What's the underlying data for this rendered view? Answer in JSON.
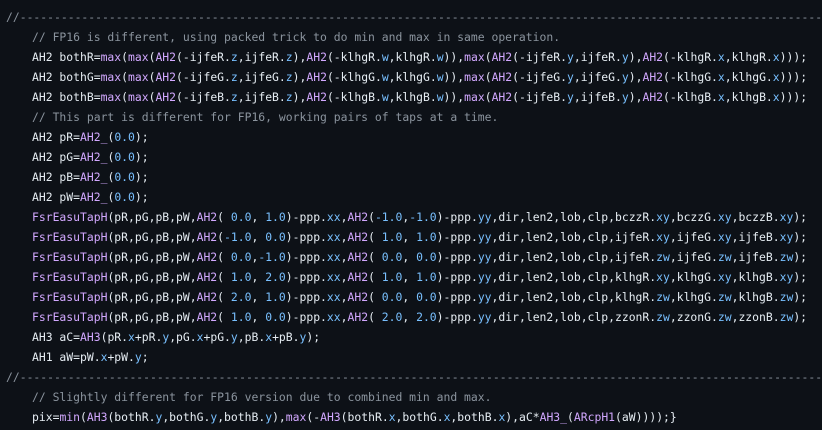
{
  "colors": {
    "background": "#0d1117",
    "plain": "#e6edf3",
    "keyword": "#d2a8ff",
    "number": "#79c0ff",
    "comment": "#8b949e"
  },
  "lines": [
    {
      "kind": "sep",
      "tokens": [
        [
          "c",
          "//---------------------------------------------------------------------------------------------------------------------"
        ]
      ]
    },
    {
      "kind": "c1",
      "tokens": [
        [
          "c",
          "// FP16 is different, using packed trick to do min and max in same operation."
        ]
      ]
    },
    {
      "kind": "c1",
      "tokens": [
        [
          "p",
          "AH2 bothR="
        ],
        [
          "k",
          "max"
        ],
        [
          "p",
          "("
        ],
        [
          "k",
          "max"
        ],
        [
          "p",
          "("
        ],
        [
          "k",
          "AH2"
        ],
        [
          "p",
          "(-ijfeR."
        ],
        [
          "n",
          "z"
        ],
        [
          "p",
          ",ijfeR."
        ],
        [
          "n",
          "z"
        ],
        [
          "p",
          "),"
        ],
        [
          "k",
          "AH2"
        ],
        [
          "p",
          "(-klhgR."
        ],
        [
          "n",
          "w"
        ],
        [
          "p",
          ",klhgR."
        ],
        [
          "n",
          "w"
        ],
        [
          "p",
          "))"
        ],
        [
          "p",
          ","
        ],
        [
          "k",
          "max"
        ],
        [
          "p",
          "("
        ],
        [
          "k",
          "AH2"
        ],
        [
          "p",
          "(-ijfeR."
        ],
        [
          "n",
          "y"
        ],
        [
          "p",
          ",ijfeR."
        ],
        [
          "n",
          "y"
        ],
        [
          "p",
          "),"
        ],
        [
          "k",
          "AH2"
        ],
        [
          "p",
          "(-klhgR."
        ],
        [
          "n",
          "x"
        ],
        [
          "p",
          ",klhgR."
        ],
        [
          "n",
          "x"
        ],
        [
          "p",
          ")));"
        ]
      ]
    },
    {
      "kind": "c1",
      "tokens": [
        [
          "p",
          "AH2 bothG="
        ],
        [
          "k",
          "max"
        ],
        [
          "p",
          "("
        ],
        [
          "k",
          "max"
        ],
        [
          "p",
          "("
        ],
        [
          "k",
          "AH2"
        ],
        [
          "p",
          "(-ijfeG."
        ],
        [
          "n",
          "z"
        ],
        [
          "p",
          ",ijfeG."
        ],
        [
          "n",
          "z"
        ],
        [
          "p",
          "),"
        ],
        [
          "k",
          "AH2"
        ],
        [
          "p",
          "(-klhgG."
        ],
        [
          "n",
          "w"
        ],
        [
          "p",
          ",klhgG."
        ],
        [
          "n",
          "w"
        ],
        [
          "p",
          "))"
        ],
        [
          "p",
          ","
        ],
        [
          "k",
          "max"
        ],
        [
          "p",
          "("
        ],
        [
          "k",
          "AH2"
        ],
        [
          "p",
          "(-ijfeG."
        ],
        [
          "n",
          "y"
        ],
        [
          "p",
          ",ijfeG."
        ],
        [
          "n",
          "y"
        ],
        [
          "p",
          "),"
        ],
        [
          "k",
          "AH2"
        ],
        [
          "p",
          "(-klhgG."
        ],
        [
          "n",
          "x"
        ],
        [
          "p",
          ",klhgG."
        ],
        [
          "n",
          "x"
        ],
        [
          "p",
          ")));"
        ]
      ]
    },
    {
      "kind": "c1",
      "tokens": [
        [
          "p",
          "AH2 bothB="
        ],
        [
          "k",
          "max"
        ],
        [
          "p",
          "("
        ],
        [
          "k",
          "max"
        ],
        [
          "p",
          "("
        ],
        [
          "k",
          "AH2"
        ],
        [
          "p",
          "(-ijfeB."
        ],
        [
          "n",
          "z"
        ],
        [
          "p",
          ",ijfeB."
        ],
        [
          "n",
          "z"
        ],
        [
          "p",
          "),"
        ],
        [
          "k",
          "AH2"
        ],
        [
          "p",
          "(-klhgB."
        ],
        [
          "n",
          "w"
        ],
        [
          "p",
          ",klhgB."
        ],
        [
          "n",
          "w"
        ],
        [
          "p",
          "))"
        ],
        [
          "p",
          ","
        ],
        [
          "k",
          "max"
        ],
        [
          "p",
          "("
        ],
        [
          "k",
          "AH2"
        ],
        [
          "p",
          "(-ijfeB."
        ],
        [
          "n",
          "y"
        ],
        [
          "p",
          ",ijfeB."
        ],
        [
          "n",
          "y"
        ],
        [
          "p",
          "),"
        ],
        [
          "k",
          "AH2"
        ],
        [
          "p",
          "(-klhgB."
        ],
        [
          "n",
          "x"
        ],
        [
          "p",
          ",klhgB."
        ],
        [
          "n",
          "x"
        ],
        [
          "p",
          ")));"
        ]
      ]
    },
    {
      "kind": "c1",
      "tokens": [
        [
          "c",
          "// This part is different for FP16, working pairs of taps at a time."
        ]
      ]
    },
    {
      "kind": "c1",
      "tokens": [
        [
          "p",
          "AH2 pR="
        ],
        [
          "k",
          "AH2_"
        ],
        [
          "p",
          "("
        ],
        [
          "n",
          "0.0"
        ],
        [
          "p",
          ");"
        ]
      ]
    },
    {
      "kind": "c1",
      "tokens": [
        [
          "p",
          "AH2 pG="
        ],
        [
          "k",
          "AH2_"
        ],
        [
          "p",
          "("
        ],
        [
          "n",
          "0.0"
        ],
        [
          "p",
          ");"
        ]
      ]
    },
    {
      "kind": "c1",
      "tokens": [
        [
          "p",
          "AH2 pB="
        ],
        [
          "k",
          "AH2_"
        ],
        [
          "p",
          "("
        ],
        [
          "n",
          "0.0"
        ],
        [
          "p",
          ");"
        ]
      ]
    },
    {
      "kind": "c1",
      "tokens": [
        [
          "p",
          "AH2 pW="
        ],
        [
          "k",
          "AH2_"
        ],
        [
          "p",
          "("
        ],
        [
          "n",
          "0.0"
        ],
        [
          "p",
          ");"
        ]
      ]
    },
    {
      "kind": "c1",
      "tokens": [
        [
          "k",
          "FsrEasuTapH"
        ],
        [
          "p",
          "(pR,pG,pB,pW,"
        ],
        [
          "k",
          "AH2"
        ],
        [
          "p",
          "( "
        ],
        [
          "n",
          "0.0"
        ],
        [
          "p",
          ", "
        ],
        [
          "n",
          "1.0"
        ],
        [
          "p",
          ")-ppp."
        ],
        [
          "n",
          "xx"
        ],
        [
          "p",
          ","
        ],
        [
          "k",
          "AH2"
        ],
        [
          "p",
          "("
        ],
        [
          "n",
          "-1.0"
        ],
        [
          "p",
          ","
        ],
        [
          "n",
          "-1.0"
        ],
        [
          "p",
          ")-ppp."
        ],
        [
          "n",
          "yy"
        ],
        [
          "p",
          ",dir,len2,lob,clp,bczzR."
        ],
        [
          "n",
          "xy"
        ],
        [
          "p",
          ",bczzG."
        ],
        [
          "n",
          "xy"
        ],
        [
          "p",
          ",bczzB."
        ],
        [
          "n",
          "xy"
        ],
        [
          "p",
          ");"
        ]
      ]
    },
    {
      "kind": "c1",
      "tokens": [
        [
          "k",
          "FsrEasuTapH"
        ],
        [
          "p",
          "(pR,pG,pB,pW,"
        ],
        [
          "k",
          "AH2"
        ],
        [
          "p",
          "("
        ],
        [
          "n",
          "-1.0"
        ],
        [
          "p",
          ", "
        ],
        [
          "n",
          "0.0"
        ],
        [
          "p",
          ")-ppp."
        ],
        [
          "n",
          "xx"
        ],
        [
          "p",
          ","
        ],
        [
          "k",
          "AH2"
        ],
        [
          "p",
          "( "
        ],
        [
          "n",
          "1.0"
        ],
        [
          "p",
          ", "
        ],
        [
          "n",
          "1.0"
        ],
        [
          "p",
          ")-ppp."
        ],
        [
          "n",
          "yy"
        ],
        [
          "p",
          ",dir,len2,lob,clp,ijfeR."
        ],
        [
          "n",
          "xy"
        ],
        [
          "p",
          ",ijfeG."
        ],
        [
          "n",
          "xy"
        ],
        [
          "p",
          ",ijfeB."
        ],
        [
          "n",
          "xy"
        ],
        [
          "p",
          ");"
        ]
      ]
    },
    {
      "kind": "c1",
      "tokens": [
        [
          "k",
          "FsrEasuTapH"
        ],
        [
          "p",
          "(pR,pG,pB,pW,"
        ],
        [
          "k",
          "AH2"
        ],
        [
          "p",
          "( "
        ],
        [
          "n",
          "0.0"
        ],
        [
          "p",
          ","
        ],
        [
          "n",
          "-1.0"
        ],
        [
          "p",
          ")-ppp."
        ],
        [
          "n",
          "xx"
        ],
        [
          "p",
          ","
        ],
        [
          "k",
          "AH2"
        ],
        [
          "p",
          "( "
        ],
        [
          "n",
          "0.0"
        ],
        [
          "p",
          ", "
        ],
        [
          "n",
          "0.0"
        ],
        [
          "p",
          ")-ppp."
        ],
        [
          "n",
          "yy"
        ],
        [
          "p",
          ",dir,len2,lob,clp,ijfeR."
        ],
        [
          "n",
          "zw"
        ],
        [
          "p",
          ",ijfeG."
        ],
        [
          "n",
          "zw"
        ],
        [
          "p",
          ",ijfeB."
        ],
        [
          "n",
          "zw"
        ],
        [
          "p",
          ");"
        ]
      ]
    },
    {
      "kind": "c1",
      "tokens": [
        [
          "k",
          "FsrEasuTapH"
        ],
        [
          "p",
          "(pR,pG,pB,pW,"
        ],
        [
          "k",
          "AH2"
        ],
        [
          "p",
          "( "
        ],
        [
          "n",
          "1.0"
        ],
        [
          "p",
          ", "
        ],
        [
          "n",
          "2.0"
        ],
        [
          "p",
          ")-ppp."
        ],
        [
          "n",
          "xx"
        ],
        [
          "p",
          ","
        ],
        [
          "k",
          "AH2"
        ],
        [
          "p",
          "( "
        ],
        [
          "n",
          "1.0"
        ],
        [
          "p",
          ", "
        ],
        [
          "n",
          "1.0"
        ],
        [
          "p",
          ")-ppp."
        ],
        [
          "n",
          "yy"
        ],
        [
          "p",
          ",dir,len2,lob,clp,klhgR."
        ],
        [
          "n",
          "xy"
        ],
        [
          "p",
          ",klhgG."
        ],
        [
          "n",
          "xy"
        ],
        [
          "p",
          ",klhgB."
        ],
        [
          "n",
          "xy"
        ],
        [
          "p",
          ");"
        ]
      ]
    },
    {
      "kind": "c1",
      "tokens": [
        [
          "k",
          "FsrEasuTapH"
        ],
        [
          "p",
          "(pR,pG,pB,pW,"
        ],
        [
          "k",
          "AH2"
        ],
        [
          "p",
          "( "
        ],
        [
          "n",
          "2.0"
        ],
        [
          "p",
          ", "
        ],
        [
          "n",
          "1.0"
        ],
        [
          "p",
          ")-ppp."
        ],
        [
          "n",
          "xx"
        ],
        [
          "p",
          ","
        ],
        [
          "k",
          "AH2"
        ],
        [
          "p",
          "( "
        ],
        [
          "n",
          "0.0"
        ],
        [
          "p",
          ", "
        ],
        [
          "n",
          "0.0"
        ],
        [
          "p",
          ")-ppp."
        ],
        [
          "n",
          "yy"
        ],
        [
          "p",
          ",dir,len2,lob,clp,klhgR."
        ],
        [
          "n",
          "zw"
        ],
        [
          "p",
          ",klhgG."
        ],
        [
          "n",
          "zw"
        ],
        [
          "p",
          ",klhgB."
        ],
        [
          "n",
          "zw"
        ],
        [
          "p",
          ");"
        ]
      ]
    },
    {
      "kind": "c1",
      "tokens": [
        [
          "k",
          "FsrEasuTapH"
        ],
        [
          "p",
          "(pR,pG,pB,pW,"
        ],
        [
          "k",
          "AH2"
        ],
        [
          "p",
          "( "
        ],
        [
          "n",
          "1.0"
        ],
        [
          "p",
          ", "
        ],
        [
          "n",
          "0.0"
        ],
        [
          "p",
          ")-ppp."
        ],
        [
          "n",
          "xx"
        ],
        [
          "p",
          ","
        ],
        [
          "k",
          "AH2"
        ],
        [
          "p",
          "( "
        ],
        [
          "n",
          "2.0"
        ],
        [
          "p",
          ", "
        ],
        [
          "n",
          "2.0"
        ],
        [
          "p",
          ")-ppp."
        ],
        [
          "n",
          "yy"
        ],
        [
          "p",
          ",dir,len2,lob,clp,zzonR."
        ],
        [
          "n",
          "zw"
        ],
        [
          "p",
          ",zzonG."
        ],
        [
          "n",
          "zw"
        ],
        [
          "p",
          ",zzonB."
        ],
        [
          "n",
          "zw"
        ],
        [
          "p",
          ");"
        ]
      ]
    },
    {
      "kind": "c1",
      "tokens": [
        [
          "p",
          "AH3 aC="
        ],
        [
          "k",
          "AH3"
        ],
        [
          "p",
          "(pR."
        ],
        [
          "n",
          "x"
        ],
        [
          "p",
          "+pR."
        ],
        [
          "n",
          "y"
        ],
        [
          "p",
          ",pG."
        ],
        [
          "n",
          "x"
        ],
        [
          "p",
          "+pG."
        ],
        [
          "n",
          "y"
        ],
        [
          "p",
          ",pB."
        ],
        [
          "n",
          "x"
        ],
        [
          "p",
          "+pB."
        ],
        [
          "n",
          "y"
        ],
        [
          "p",
          ");"
        ]
      ]
    },
    {
      "kind": "c1",
      "tokens": [
        [
          "p",
          "AH1 aW=pW."
        ],
        [
          "n",
          "x"
        ],
        [
          "p",
          "+pW."
        ],
        [
          "n",
          "y"
        ],
        [
          "p",
          ";"
        ]
      ]
    },
    {
      "kind": "sep",
      "tokens": [
        [
          "c",
          "//---------------------------------------------------------------------------------------------------------------------"
        ]
      ]
    },
    {
      "kind": "c1",
      "tokens": [
        [
          "c",
          "// Slightly different for FP16 version due to combined min and max."
        ]
      ]
    },
    {
      "kind": "c1",
      "tokens": [
        [
          "p",
          "pix="
        ],
        [
          "k",
          "min"
        ],
        [
          "p",
          "("
        ],
        [
          "k",
          "AH3"
        ],
        [
          "p",
          "(bothR."
        ],
        [
          "n",
          "y"
        ],
        [
          "p",
          ",bothG."
        ],
        [
          "n",
          "y"
        ],
        [
          "p",
          ",bothB."
        ],
        [
          "n",
          "y"
        ],
        [
          "p",
          "),"
        ],
        [
          "k",
          "max"
        ],
        [
          "p",
          "(-"
        ],
        [
          "k",
          "AH3"
        ],
        [
          "p",
          "(bothR."
        ],
        [
          "n",
          "x"
        ],
        [
          "p",
          ",bothG."
        ],
        [
          "n",
          "x"
        ],
        [
          "p",
          ",bothB."
        ],
        [
          "n",
          "x"
        ],
        [
          "p",
          "),aC*"
        ],
        [
          "k",
          "AH3_"
        ],
        [
          "p",
          "("
        ],
        [
          "k",
          "ARcpH1"
        ],
        [
          "p",
          "(aW))));}"
        ]
      ]
    }
  ]
}
